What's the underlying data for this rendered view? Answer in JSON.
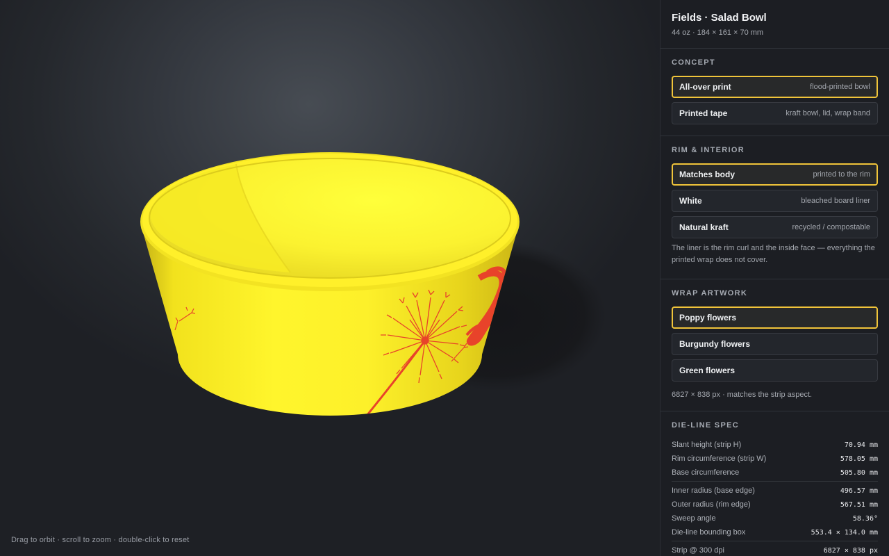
{
  "viewport": {
    "hint": "Drag to orbit · scroll to zoom · double-click to reset",
    "bowl_color": "#ffee22",
    "print_color": "#e8432a"
  },
  "product": {
    "title": "Fields · Salad Bowl",
    "subtitle": "44 oz · 184 × 161 × 70 mm"
  },
  "concept": {
    "title": "CONCEPT",
    "options": [
      {
        "label": "All-over print",
        "desc": "flood-printed bowl",
        "selected": true
      },
      {
        "label": "Printed tape",
        "desc": "kraft bowl, lid, wrap band",
        "selected": false
      }
    ]
  },
  "rim": {
    "title": "RIM & INTERIOR",
    "options": [
      {
        "label": "Matches body",
        "desc": "printed to the rim",
        "selected": true
      },
      {
        "label": "White",
        "desc": "bleached board liner",
        "selected": false
      },
      {
        "label": "Natural kraft",
        "desc": "recycled / compostable",
        "selected": false
      }
    ],
    "note": "The liner is the rim curl and the inside face — everything the printed wrap does not cover."
  },
  "artwork": {
    "title": "WRAP ARTWORK",
    "options": [
      {
        "label": "Poppy flowers",
        "selected": true
      },
      {
        "label": "Burgundy flowers",
        "selected": false
      },
      {
        "label": "Green flowers",
        "selected": false
      }
    ],
    "note": "6827 × 838 px · matches the strip aspect."
  },
  "dieline": {
    "title": "DIE-LINE SPEC",
    "rows": [
      {
        "label": "Slant height (strip H)",
        "value": "70.94 mm"
      },
      {
        "label": "Rim circumference (strip W)",
        "value": "578.05 mm"
      },
      {
        "label": "Base circumference",
        "value": "505.80 mm"
      },
      {
        "label": "Inner radius (base edge)",
        "value": "496.57 mm"
      },
      {
        "label": "Outer radius (rim edge)",
        "value": "567.51 mm"
      },
      {
        "label": "Sweep angle",
        "value": "58.36°"
      },
      {
        "label": "Die-line bounding box",
        "value": "553.4 × 134.0 mm"
      },
      {
        "label": "Strip @ 300 dpi",
        "value": "6827 × 838 px"
      }
    ]
  },
  "colors": {
    "accent": "#f0c43a",
    "panel_bg": "#1c1e23"
  }
}
